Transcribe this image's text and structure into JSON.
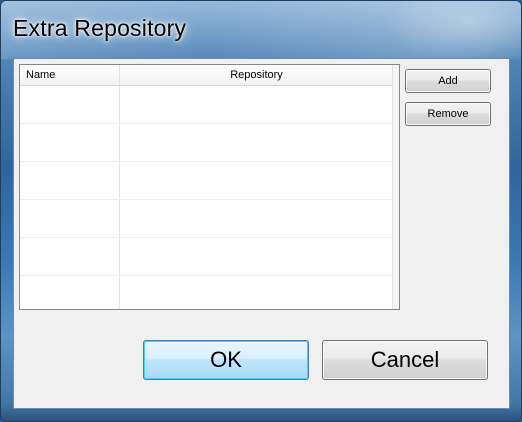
{
  "window": {
    "title": "Extra Repository"
  },
  "table": {
    "columns": [
      "Name",
      "Repository"
    ],
    "rows": [
      {
        "name": "",
        "repository": ""
      },
      {
        "name": "",
        "repository": ""
      },
      {
        "name": "",
        "repository": ""
      },
      {
        "name": "",
        "repository": ""
      },
      {
        "name": "",
        "repository": ""
      },
      {
        "name": "",
        "repository": ""
      }
    ]
  },
  "buttons": {
    "add": "Add",
    "remove": "Remove",
    "ok": "OK",
    "cancel": "Cancel"
  },
  "colors": {
    "ok_accent": "#3c7fb1",
    "frame": "#3a79b3"
  }
}
